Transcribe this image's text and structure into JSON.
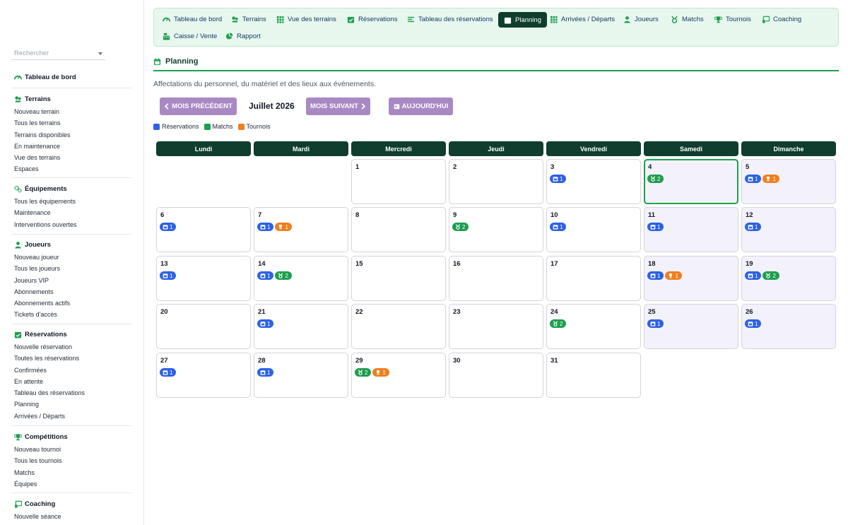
{
  "sidebar": {
    "search_placeholder": "Rechercher",
    "dashboard": "Tableau de bord",
    "groups": [
      {
        "title": "Terrains",
        "links": [
          "Nouveau terrain",
          "Tous les terrains",
          "Terrains disponibles",
          "En maintenance",
          "Vue des terrains",
          "Espaces"
        ]
      },
      {
        "title": "Équipements",
        "links": [
          "Tous les équipements",
          "Maintenance",
          "Interventions ouvertes"
        ]
      },
      {
        "title": "Joueurs",
        "links": [
          "Nouveau joueur",
          "Tous les joueurs",
          "Joueurs VIP",
          "Abonnements",
          "Abonnements actifs",
          "Tickets d'accès"
        ]
      },
      {
        "title": "Réservations",
        "links": [
          "Nouvelle réservation",
          "Toutes les réservations",
          "Confirmées",
          "En attente",
          "Tableau des réservations",
          "Planning",
          "Arrivées / Départs"
        ]
      },
      {
        "title": "Compétitions",
        "links": [
          "Nouveau tournoi",
          "Tous les tournois",
          "Matchs",
          "Équipes"
        ]
      },
      {
        "title": "Coaching",
        "links": [
          "Nouvelle séance"
        ]
      }
    ]
  },
  "nav": {
    "items": [
      {
        "label": "Tableau de bord",
        "icon": "gauge-icon"
      },
      {
        "label": "Terrains",
        "icon": "court-icon"
      },
      {
        "label": "Vue des terrains",
        "icon": "grid-icon"
      },
      {
        "label": "Réservations",
        "icon": "calendar-check-icon"
      },
      {
        "label": "Tableau des réservations",
        "icon": "list-icon"
      },
      {
        "label": "Planning",
        "icon": "calendar-icon",
        "active": true
      },
      {
        "label": "Arrivées / Départs",
        "icon": "grid-icon"
      },
      {
        "label": "Joueurs",
        "icon": "user-icon"
      },
      {
        "label": "Matchs",
        "icon": "medal-icon"
      },
      {
        "label": "Tournois",
        "icon": "trophy-icon"
      },
      {
        "label": "Coaching",
        "icon": "whistle-board-icon"
      },
      {
        "label": "Caisse / Vente",
        "icon": "cash-register-icon"
      },
      {
        "label": "Rapport",
        "icon": "pie-chart-icon"
      }
    ]
  },
  "main": {
    "title": "Planning",
    "subtitle": "Affectations du personnel, du matériel et des lieux aux événements.",
    "prev_label": "MOIS PRÉCÉDENT",
    "month_label": "Juillet 2026",
    "next_label": "MOIS SUIVANT",
    "today_label": "AUJOURD'HUI"
  },
  "legend": [
    {
      "label": "Réservations",
      "color": "#2c62e3"
    },
    {
      "label": "Matchs",
      "color": "#1e9e4e"
    },
    {
      "label": "Tournois",
      "color": "#f07f1e"
    }
  ],
  "weekdays": [
    "Lundi",
    "Mardi",
    "Mercredi",
    "Jeudi",
    "Vendredi",
    "Samedi",
    "Dimanche"
  ],
  "calendar": {
    "first_weekday_index": 2,
    "today": 4,
    "days": [
      {
        "d": 1
      },
      {
        "d": 2
      },
      {
        "d": 3,
        "res": 1
      },
      {
        "d": 4,
        "match": 2
      },
      {
        "d": 5,
        "res": 1,
        "tour": 1
      },
      {
        "d": 6,
        "res": 1
      },
      {
        "d": 7,
        "res": 1,
        "tour": 1
      },
      {
        "d": 8
      },
      {
        "d": 9,
        "match": 2
      },
      {
        "d": 10,
        "res": 1
      },
      {
        "d": 11,
        "res": 1
      },
      {
        "d": 12,
        "res": 1
      },
      {
        "d": 13,
        "res": 1
      },
      {
        "d": 14,
        "res": 1,
        "match": 2
      },
      {
        "d": 15
      },
      {
        "d": 16
      },
      {
        "d": 17
      },
      {
        "d": 18,
        "res": 1,
        "tour": 1
      },
      {
        "d": 19,
        "res": 1,
        "match": 2
      },
      {
        "d": 20
      },
      {
        "d": 21,
        "res": 1
      },
      {
        "d": 22
      },
      {
        "d": 23
      },
      {
        "d": 24,
        "match": 2
      },
      {
        "d": 25,
        "res": 1
      },
      {
        "d": 26,
        "res": 1
      },
      {
        "d": 27,
        "res": 1
      },
      {
        "d": 28,
        "res": 1
      },
      {
        "d": 29,
        "match": 2,
        "tour": 1
      },
      {
        "d": 30
      },
      {
        "d": 31
      }
    ]
  }
}
